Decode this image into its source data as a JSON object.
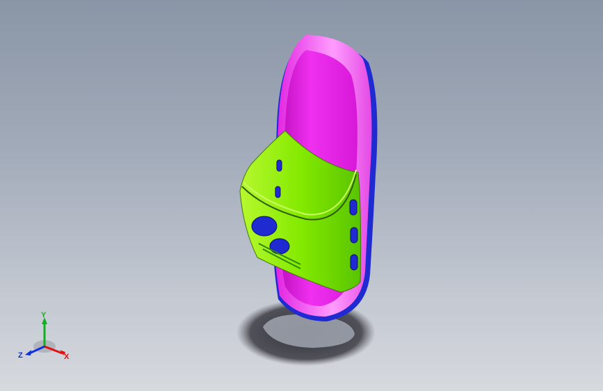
{
  "viewport": {
    "background_top": "#8a95a6",
    "background_bottom": "#d6d9de"
  },
  "model": {
    "sole_color": "#ee22e6",
    "strap_color": "#7ee400",
    "accent_color": "#1f2bd0",
    "shadow_color": "#2d2d33"
  },
  "triad": {
    "x_label": "X",
    "y_label": "Y",
    "z_label": "Z",
    "x_color": "#e01010",
    "y_color": "#10b020",
    "z_color": "#1030e0"
  }
}
